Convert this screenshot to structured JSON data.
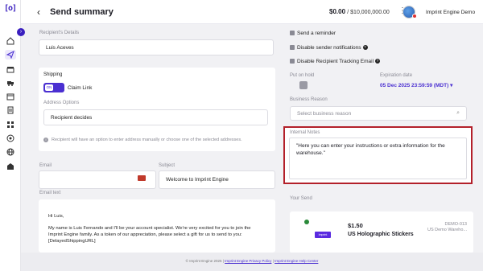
{
  "header": {
    "title": "Send summary",
    "balance": "$0.00",
    "balance_total": "/ $10,000,000.00",
    "account_name": "Imprint Engine Demo"
  },
  "left": {
    "recipient_label": "Recipient's Details",
    "recipient_name": "Luis Aceves",
    "shipping_label": "Shipping",
    "toggle_text": "ON",
    "claim_link": "Claim Link",
    "address_options_label": "Address Options",
    "address_value": "Recipient decides",
    "address_info": "Recipient will have an option to enter address manually or choose one of the selected addresses.",
    "email_label": "Email",
    "subject_label": "Subject",
    "subject_value": "Welcome to Imprint Engine",
    "email_text_label": "Email text",
    "email_greeting": "Hi Luis,",
    "email_body_1": "My name is Luis Fernando and I'll be your account specialist. We're very excited for you to join the Imprint Engine family. As a token of our appreciation, please select a gift for us to send to you:",
    "email_placeholder": "[DelayedShippingURL]"
  },
  "right": {
    "send_reminder": "Send a reminder",
    "disable_sender": "Disable sender notifications",
    "disable_tracking": "Disable Recipient Tracking Email",
    "put_on_hold": "Put on hold",
    "expiration_label": "Expiration date",
    "expiration_value": "05 Dec 2025 23:59:59 (MDT)",
    "business_reason_label": "Business Reason",
    "business_reason_placeholder": "Select business reason",
    "internal_notes_label": "Internal Notes",
    "internal_notes_text": "\"Here you can enter your instructions or extra information for the warehouse.\"",
    "your_send_label": "Your Send",
    "product_price": "$1.50",
    "product_name": "US Holographic Stickers",
    "product_code": "DEMO-013",
    "product_warehouse": "US Demo Wareho...",
    "product_image_text": "Imprint Engine"
  },
  "footer": {
    "copyright": "© Imprint Engine 2025",
    "privacy": "Imprint Engine Privacy Policy",
    "help": "Imprint Engine Help Center"
  },
  "colors": {
    "accent": "#4a2fd1",
    "highlight_border": "#b3202a",
    "background": "#f1f1f4"
  }
}
